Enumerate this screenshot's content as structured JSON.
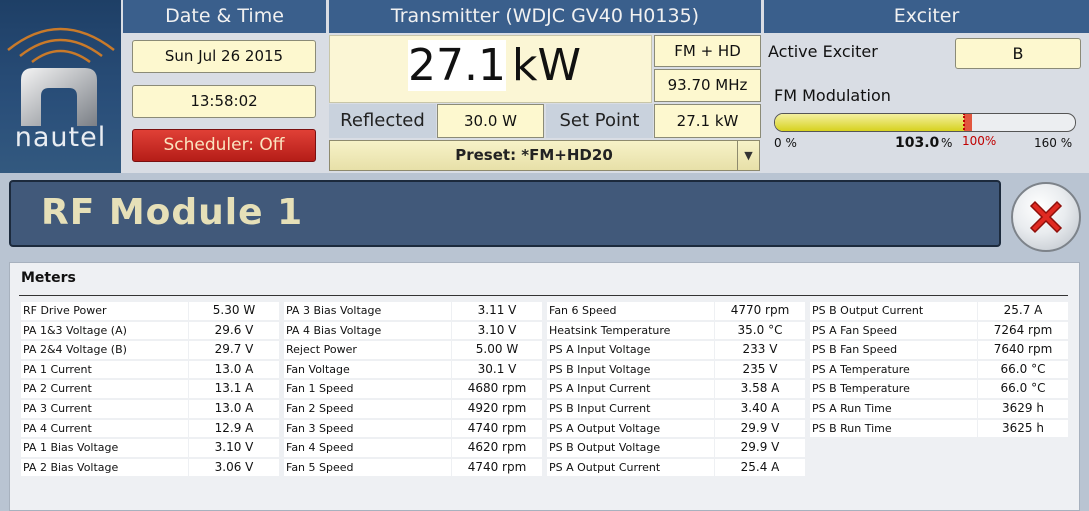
{
  "logo": {
    "text": "nautel"
  },
  "date_time": {
    "header": "Date & Time",
    "date": "Sun Jul 26 2015",
    "time": "13:58:02",
    "scheduler": "Scheduler: Off"
  },
  "transmitter": {
    "header": "Transmitter (WDJC GV40 H0135)",
    "power_value": "27.1",
    "power_unit": "kW",
    "mode": "FM + HD",
    "frequency": "93.70 MHz",
    "reflected_label": "Reflected",
    "reflected_value": "30.0 W",
    "setpoint_label": "Set Point",
    "setpoint_value": "27.1 kW",
    "preset": "Preset: *FM+HD20"
  },
  "exciter": {
    "header": "Exciter",
    "active_label": "Active Exciter",
    "active_value": "B",
    "modulation_label": "FM Modulation",
    "modulation_min": "0 %",
    "modulation_value": "103.0",
    "modulation_value_unit": "%",
    "modulation_marker": "100%",
    "modulation_max": "160 %",
    "modulation_level_percent": 103.0,
    "modulation_scale_max": 160
  },
  "module": {
    "title": "RF Module 1",
    "meters_title": "Meters"
  },
  "meters": [
    [
      {
        "label": "RF Drive Power",
        "value": "5.30 W"
      },
      {
        "label": "PA 1&3 Voltage (A)",
        "value": "29.6 V"
      },
      {
        "label": "PA 2&4 Voltage (B)",
        "value": "29.7 V"
      },
      {
        "label": "PA 1 Current",
        "value": "13.0 A"
      },
      {
        "label": "PA 2 Current",
        "value": "13.1 A"
      },
      {
        "label": "PA 3 Current",
        "value": "13.0 A"
      },
      {
        "label": "PA 4 Current",
        "value": "12.9 A"
      },
      {
        "label": "PA 1 Bias Voltage",
        "value": "3.10 V"
      },
      {
        "label": "PA 2 Bias Voltage",
        "value": "3.06 V"
      }
    ],
    [
      {
        "label": "PA 3 Bias Voltage",
        "value": "3.11 V"
      },
      {
        "label": "PA 4 Bias Voltage",
        "value": "3.10 V"
      },
      {
        "label": "Reject Power",
        "value": "5.00 W"
      },
      {
        "label": "Fan Voltage",
        "value": "30.1 V"
      },
      {
        "label": "Fan 1 Speed",
        "value": "4680 rpm"
      },
      {
        "label": "Fan 2 Speed",
        "value": "4920 rpm"
      },
      {
        "label": "Fan 3 Speed",
        "value": "4740 rpm"
      },
      {
        "label": "Fan 4 Speed",
        "value": "4620 rpm"
      },
      {
        "label": "Fan 5 Speed",
        "value": "4740 rpm"
      }
    ],
    [
      {
        "label": "Fan 6 Speed",
        "value": "4770 rpm"
      },
      {
        "label": "Heatsink Temperature",
        "value": "35.0 °C"
      },
      {
        "label": "PS A Input Voltage",
        "value": "233 V"
      },
      {
        "label": "PS B Input Voltage",
        "value": "235 V"
      },
      {
        "label": "PS A Input Current",
        "value": "3.58 A"
      },
      {
        "label": "PS B Input Current",
        "value": "3.40 A"
      },
      {
        "label": "PS A Output Voltage",
        "value": "29.9 V"
      },
      {
        "label": "PS B Output Voltage",
        "value": "29.9 V"
      },
      {
        "label": "PS A Output Current",
        "value": "25.4 A"
      }
    ],
    [
      {
        "label": "PS B Output Current",
        "value": "25.7 A"
      },
      {
        "label": "PS A Fan Speed",
        "value": "7264 rpm"
      },
      {
        "label": "PS B Fan Speed",
        "value": "7640 rpm"
      },
      {
        "label": "PS A Temperature",
        "value": "66.0 °C"
      },
      {
        "label": "PS B Temperature",
        "value": "66.0 °C"
      },
      {
        "label": "PS A Run Time",
        "value": "3629 h"
      },
      {
        "label": "PS B Run Time",
        "value": "3625 h"
      }
    ]
  ],
  "colors": {
    "header_blue": "#3a5f8c",
    "value_yellow": "#fdf8cf",
    "scheduler_red": "#c8261f",
    "title_text": "#e6e0b8",
    "modulation_fill": "#e3de2a"
  },
  "icons": {
    "close": "close-icon",
    "dropdown": "chevron-down-icon",
    "logo": "nautel-logo"
  }
}
